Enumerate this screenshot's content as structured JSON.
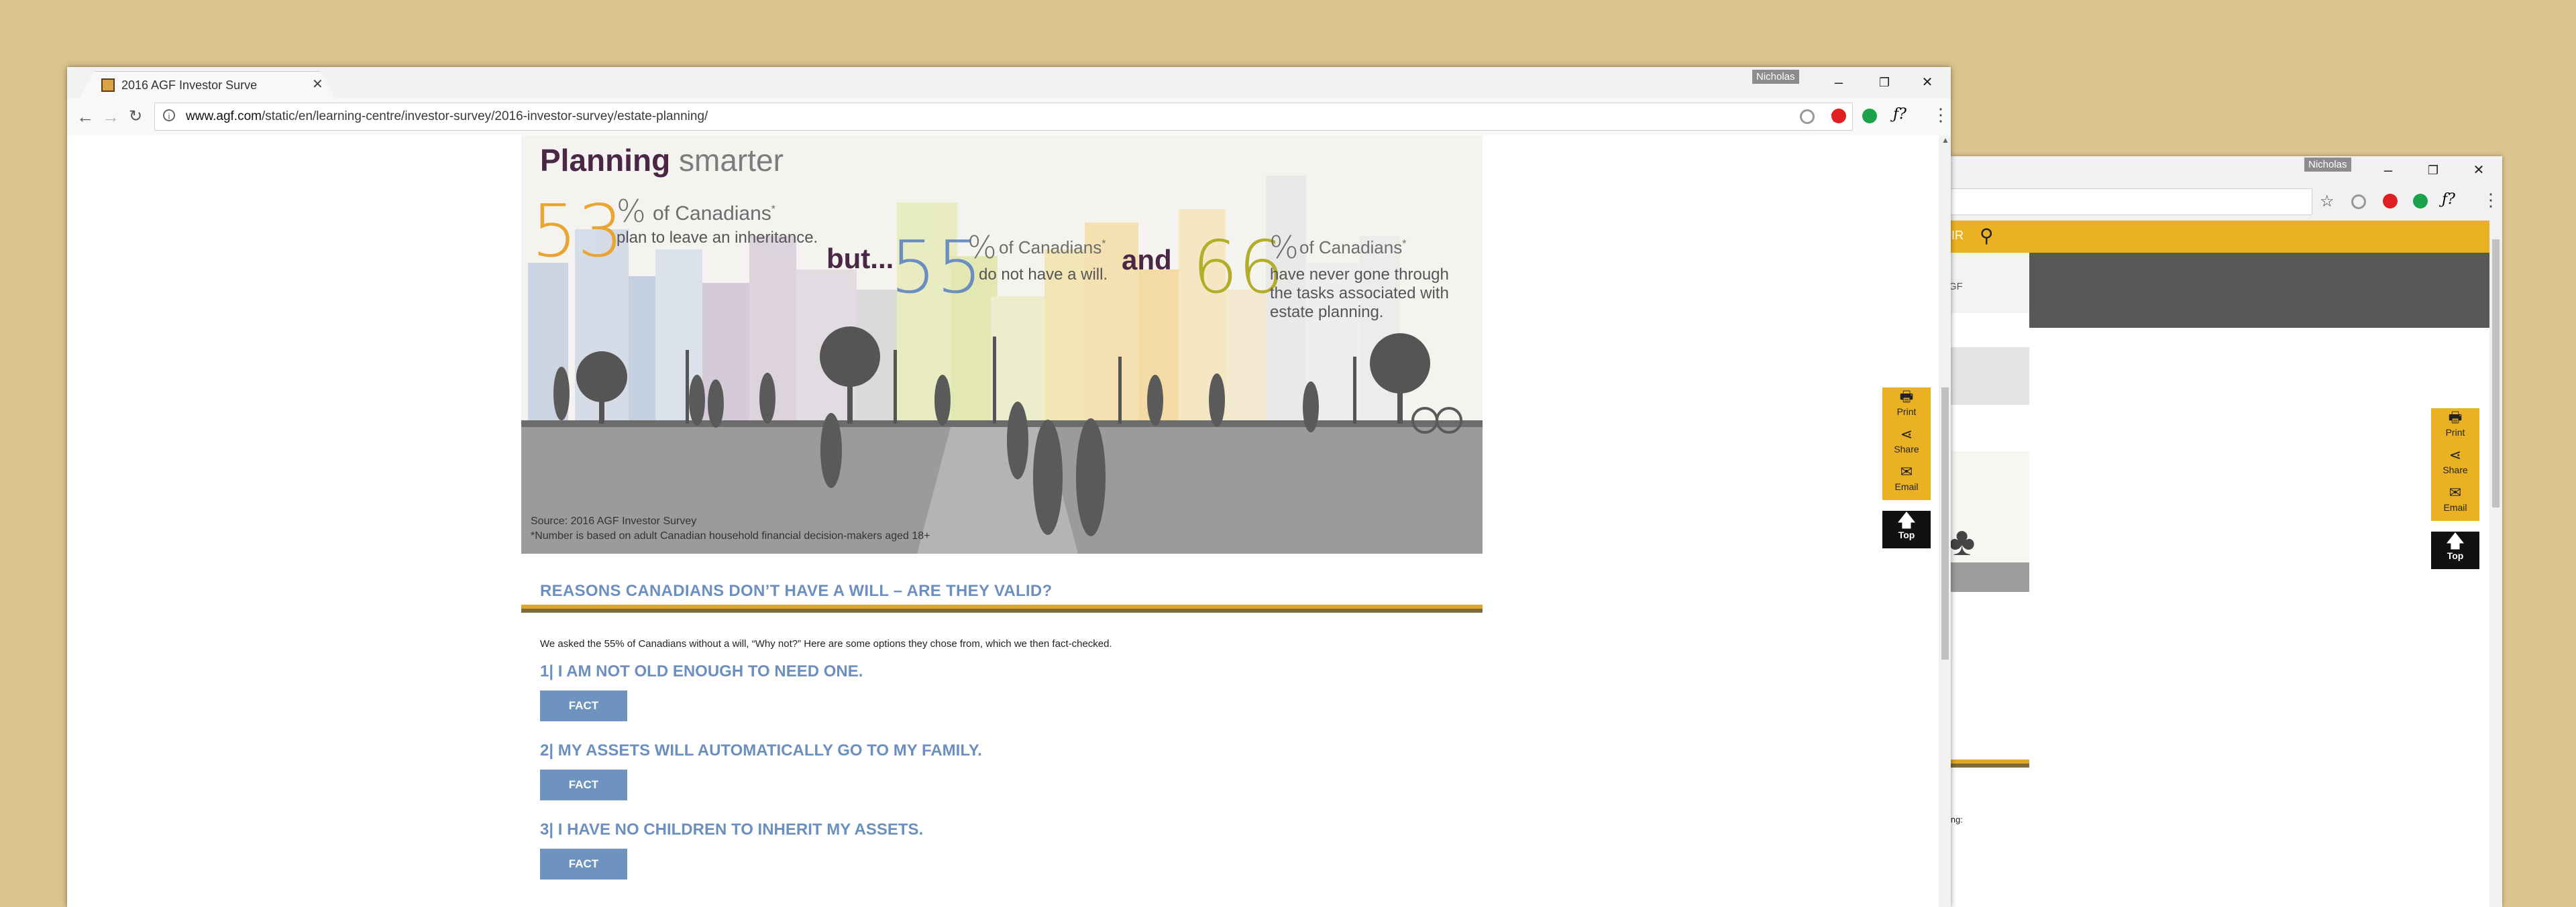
{
  "main_window": {
    "tab_title": "2016 AGF Investor Surve",
    "user_badge": "Nicholas",
    "url_domain": "www.agf.com",
    "url_path": "/static/en/learning-centre/investor-survey/2016-investor-survey/estate-planning/",
    "window_controls": {
      "minimize": "–",
      "restore": "❐",
      "close": "✕"
    }
  },
  "infographic": {
    "title_bold": "Planning",
    "title_light": "smarter",
    "stat1": {
      "num": "53",
      "pct": "%",
      "of": "of Canadians",
      "star": "*",
      "desc": "plan to leave an inheritance."
    },
    "but": "but...",
    "stat2": {
      "num": "55",
      "pct": "%",
      "of": "of Canadians",
      "star": "*",
      "desc": "do not have a will."
    },
    "and": "and",
    "stat3": {
      "num": "66",
      "pct": "%",
      "of": "of Canadians",
      "star": "*",
      "desc": "have never gone through the tasks associated with estate planning."
    },
    "source": "Source: 2016 AGF Investor Survey",
    "footnote": "*Number is based on adult Canadian household financial decision-makers aged 18+"
  },
  "content": {
    "section_heading": "REASONS CANADIANS DON’T HAVE A WILL – ARE THEY VALID?",
    "intro": "We asked the 55% of Canadians without a will, “Why not?” Here are some options they chose from, which we then fact-checked.",
    "reasons": [
      {
        "label": "1| I AM NOT OLD ENOUGH TO NEED ONE.",
        "button": "FACT"
      },
      {
        "label": "2| MY ASSETS WILL AUTOMATICALLY GO TO MY FAMILY.",
        "button": "FACT"
      },
      {
        "label": "3| I HAVE NO CHILDREN TO INHERIT MY ASSETS.",
        "button": "FACT"
      }
    ]
  },
  "floating_actions": {
    "print": "Print",
    "share": "Share",
    "email": "Email",
    "top": "Top"
  },
  "back_window": {
    "user_badge": "Nicholas",
    "nav_fragment": "IR",
    "sidebar_fragment": "GF",
    "text_fragment": "ing:",
    "window_controls": {
      "minimize": "–",
      "restore": "❐",
      "close": "✕"
    }
  },
  "colors": {
    "stat1": "#e8a532",
    "stat2": "#6a8ec0",
    "stat3": "#b2ae2a",
    "accent_gold": "#eab223",
    "heading_blue": "#6b90c0",
    "brand_purple": "#4b2746"
  },
  "icons": [
    "back-arrow-icon",
    "forward-arrow-icon",
    "reload-icon",
    "info-icon",
    "star-icon",
    "print-icon",
    "share-icon",
    "email-icon",
    "up-arrow-icon",
    "search-icon",
    "menu-icon"
  ]
}
